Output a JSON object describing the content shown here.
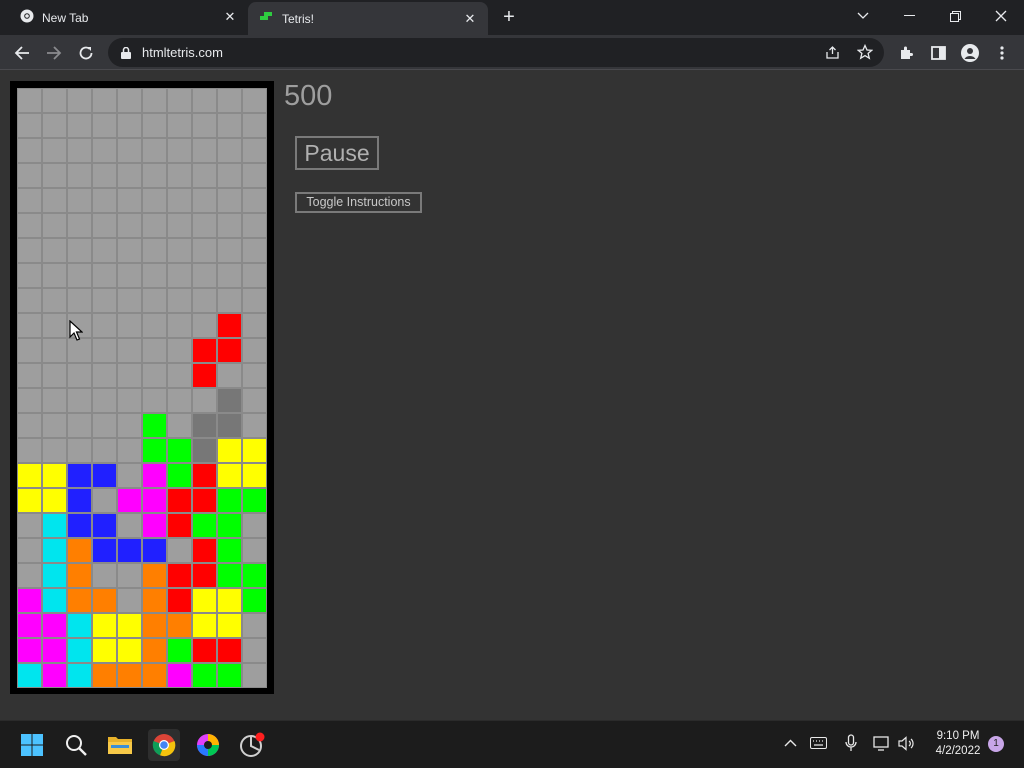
{
  "browser": {
    "tabs": [
      {
        "title": "New Tab",
        "active": false
      },
      {
        "title": "Tetris!",
        "active": true
      }
    ],
    "url": "htmltetris.com"
  },
  "game": {
    "score": "500",
    "pause_label": "Pause",
    "instructions_label": "Toggle Instructions",
    "board": {
      "columns": 10,
      "rows": 24,
      "colors": {
        "R": "#ff0000",
        "G": "#00ff00",
        "B": "#2020ff",
        "Y": "#ffff00",
        "C": "#00e5ee",
        "M": "#ff00ff",
        "O": "#ff7f00",
        "D": "#777777",
        ".": "#9e9e9e"
      },
      "grid": [
        "..........",
        "..........",
        "..........",
        "..........",
        "..........",
        "..........",
        "..........",
        "..........",
        "..........",
        "........R.",
        ".......RR.",
        ".......R..",
        "........D.",
        ".....G.DD.",
        ".....GGDYY",
        "YYBB.MGRYY",
        "YYB.MMRRGG",
        ".CBB.MRGG.",
        ".COBBB.RG.",
        ".CO..ORRGG",
        "MCOO.ORYYG",
        "MMCYYOOYY.",
        "MMCYYOGRR.",
        "CMCOOOMGG."
      ]
    }
  },
  "taskbar": {
    "time": "9:10 PM",
    "date": "4/2/2022",
    "notification_count": "1"
  }
}
